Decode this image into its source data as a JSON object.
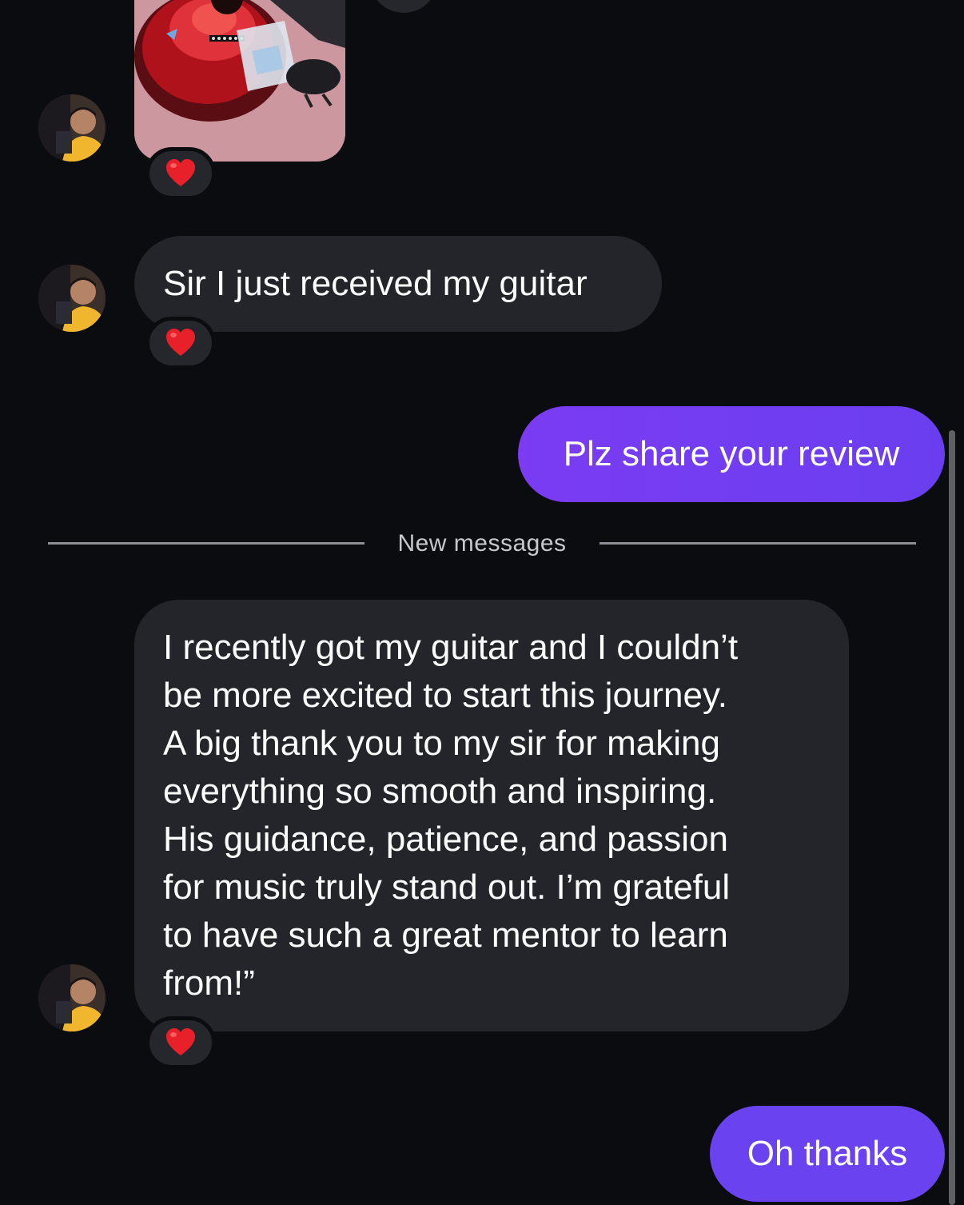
{
  "messages": {
    "photo": {
      "sender": "other",
      "content": "guitar-photo",
      "reaction": "red-heart"
    },
    "msg1": {
      "sender": "other",
      "text": "Sir I just received my guitar",
      "reaction": "red-heart"
    },
    "msg2": {
      "sender": "me",
      "text": "Plz share your review"
    },
    "divider": {
      "label": "New messages"
    },
    "msg3": {
      "sender": "other",
      "lines": [
        "I recently got my guitar and I couldn’t",
        "be more excited to start this journey.",
        "A big thank you to my sir for making",
        "everything so smooth and inspiring.",
        "His guidance, patience, and passion",
        "for music truly stand out. I’m grateful",
        "to have such a great mentor to learn",
        "from!”"
      ],
      "reaction": "red-heart"
    },
    "msg4": {
      "sender": "me",
      "text": "Oh thanks"
    }
  },
  "colors": {
    "background": "#0b0c10",
    "incoming_bubble": "#24252b",
    "outgoing_bubble": "#7b3cf2",
    "heart": "#e8202a"
  }
}
